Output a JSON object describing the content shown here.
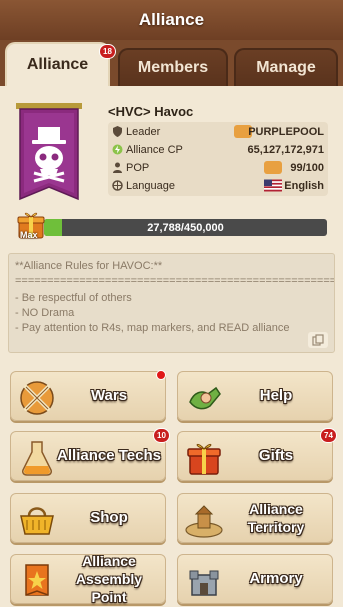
{
  "header": {
    "title": "Alliance"
  },
  "tabs": [
    {
      "label": "Alliance",
      "badge": "18",
      "active": true
    },
    {
      "label": "Members"
    },
    {
      "label": "Manage"
    }
  ],
  "alliance": {
    "name": "<HVC> Havoc",
    "info": [
      {
        "label": "Leader",
        "value": "PURPLEPOOL",
        "icon": "shield-icon",
        "value_icon": "chat-icon"
      },
      {
        "label": "Alliance CP",
        "value": "65,127,172,971",
        "icon": "power-icon"
      },
      {
        "label": "POP",
        "value": "99/100",
        "icon": "person-icon",
        "value_icon": "mail-icon"
      },
      {
        "label": "Language",
        "value": "English",
        "icon": "language-icon",
        "value_icon": "us-flag-icon"
      }
    ]
  },
  "progress": {
    "text": "27,788/450,000",
    "fraction": 0.062,
    "max_label": "Max"
  },
  "rules": {
    "lines": [
      "**Alliance Rules for HAVOC:**",
      "==================================================",
      "- Be respectful of others",
      "- NO Drama",
      "- Pay attention to R4s, map markers, and READ alliance"
    ]
  },
  "buttons": [
    {
      "label": "Wars",
      "icon": "crossed-swords-icon",
      "dot": true
    },
    {
      "label": "Help",
      "icon": "handshake-icon"
    },
    {
      "label": "Alliance Techs",
      "icon": "flask-icon",
      "badge": "10"
    },
    {
      "label": "Gifts",
      "icon": "gift-box-icon",
      "badge": "74"
    },
    {
      "label": "Shop",
      "icon": "basket-icon"
    },
    {
      "label": "Alliance Territory",
      "icon": "territory-icon"
    },
    {
      "label": "Alliance Assembly Point",
      "icon": "assembly-flag-icon"
    },
    {
      "label": "Armory",
      "icon": "armory-icon"
    }
  ],
  "colors": {
    "background": "#7a4a2c",
    "panel": "#f2e8d5",
    "banner": "#8b2a7e",
    "progress_fill": "#6fbf3a",
    "badge": "#c81e1e"
  }
}
